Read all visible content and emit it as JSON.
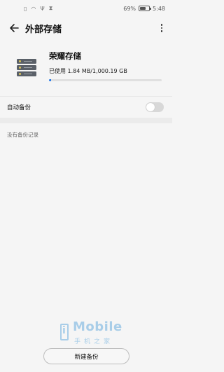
{
  "status_bar": {
    "battery_percent": "69%",
    "battery_level": 0.69,
    "time": "5:48",
    "icons": [
      "sim-icon",
      "wifi-icon",
      "usb-icon",
      "hourglass-icon"
    ]
  },
  "app_bar": {
    "title": "外部存储",
    "back_icon": "arrow-left-icon",
    "more_icon": "more-vertical-icon"
  },
  "storage": {
    "name": "荣耀存储",
    "used_text": "已使用 1.84 MB/1,000.19 GB",
    "used_fraction": 0.02,
    "accent": "#2b7de9",
    "icon": "nas-drive-icon"
  },
  "auto_backup": {
    "label": "自动备份",
    "enabled": false
  },
  "backup_records": {
    "empty_text": "没有备份记录"
  },
  "watermark": {
    "brand": "Mobile",
    "sub": "手机之家"
  },
  "actions": {
    "new_backup_label": "新建备份"
  }
}
